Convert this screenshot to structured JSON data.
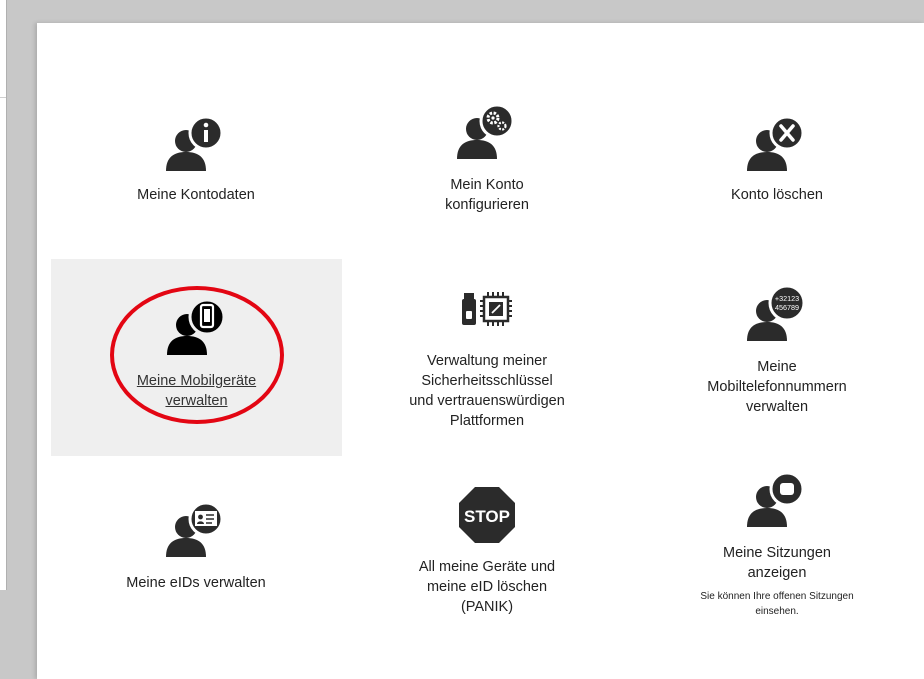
{
  "tiles": [
    {
      "id": "meine-kontodaten",
      "label": "Meine Kontodaten",
      "icon": "user-info-icon"
    },
    {
      "id": "mein-konto-konfigurieren",
      "label": "Mein Konto\nkonfigurieren",
      "icon": "user-gear-icon"
    },
    {
      "id": "konto-loeschen",
      "label": "Konto löschen",
      "icon": "user-delete-icon"
    },
    {
      "id": "mobilgeraete",
      "label": "Meine Mobilgeräte\nverwalten",
      "icon": "user-mobile-icon",
      "active": true
    },
    {
      "id": "sicherheitsschluessel",
      "label": "Verwaltung meiner\nSicherheitsschlüssel\nund vertrauenswürdigen\nPlattformen",
      "icon": "usb-chip-icon"
    },
    {
      "id": "mobiltelefonnummern",
      "label": "Meine\nMobiltelefonnummern\nverwalten",
      "icon": "user-phone-number-icon",
      "badge": "+32123\n456789"
    },
    {
      "id": "eids",
      "label": "Meine eIDs verwalten",
      "icon": "user-id-card-icon"
    },
    {
      "id": "panik",
      "label": "All meine Geräte und\nmeine eID löschen\n(PANIK)",
      "icon": "stop-sign-icon",
      "badge": "STOP"
    },
    {
      "id": "sitzungen",
      "label": "Meine Sitzungen\nanzeigen",
      "icon": "user-session-icon",
      "sub": "Sie können Ihre offenen Sitzungen\neinsehen."
    }
  ],
  "colors": {
    "icon": "#2b2b2b",
    "annotation": "#e30613",
    "active_tile": "#efefef"
  }
}
